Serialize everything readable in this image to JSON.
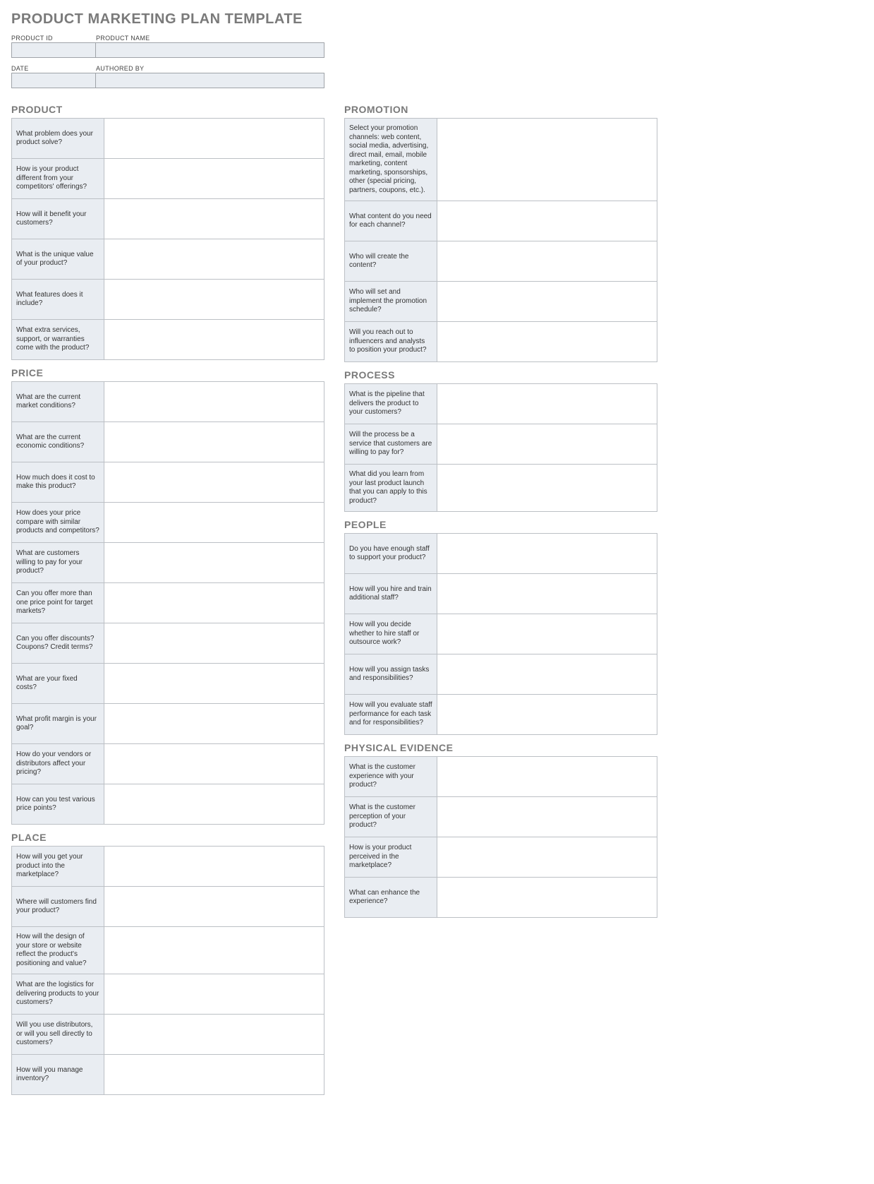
{
  "title": "PRODUCT MARKETING PLAN TEMPLATE",
  "meta": {
    "product_id": {
      "label": "PRODUCT ID",
      "value": ""
    },
    "product_name": {
      "label": "PRODUCT NAME",
      "value": ""
    },
    "date": {
      "label": "DATE",
      "value": ""
    },
    "authored_by": {
      "label": "AUTHORED BY",
      "value": ""
    }
  },
  "left": {
    "product": {
      "title": "PRODUCT",
      "rows": [
        "What problem does your product solve?",
        "How is your product different from your competitors' offerings?",
        "How will it benefit your customers?",
        "What is the unique value of your product?",
        "What features does it include?",
        "What extra services, support, or warranties come with the product?"
      ]
    },
    "price": {
      "title": "PRICE",
      "rows": [
        "What are the current market conditions?",
        "What are the current economic conditions?",
        "How much does it cost to make this product?",
        "How does your price compare with similar products and competitors?",
        "What are customers willing to pay for your product?",
        "Can you offer more than one price point for target markets?",
        "Can you offer discounts? Coupons? Credit terms?",
        "What are your fixed costs?",
        "What profit margin is your goal?",
        "How do your vendors or distributors affect your pricing?",
        "How can you test various price points?"
      ]
    },
    "place": {
      "title": "PLACE",
      "rows": [
        "How will you get your product into the marketplace?",
        "Where will customers find your product?",
        "How will the design of your store or website reflect the product's positioning and value?",
        "What are the logistics for delivering products to your customers?",
        "Will you use distributors, or will you sell directly to customers?",
        "How will you manage inventory?"
      ]
    }
  },
  "right": {
    "promotion": {
      "title": "PROMOTION",
      "rows": [
        "Select your promotion channels: web content, social media, advertising, direct mail, email, mobile marketing, content marketing, sponsorships, other (special pricing, partners, coupons, etc.).",
        "What content do you need for each channel?",
        "Who will create the content?",
        "Who will set and implement the promotion schedule?",
        "Will you reach out to influencers and analysts to position your product?"
      ]
    },
    "process": {
      "title": "PROCESS",
      "rows": [
        "What is the pipeline that delivers the product to your customers?",
        "Will the process be a service that customers are willing to pay for?",
        "What did you learn from your last product launch that you can apply to this product?"
      ]
    },
    "people": {
      "title": "PEOPLE",
      "rows": [
        "Do you have enough staff to support your product?",
        "How will you hire and train additional staff?",
        "How will you decide whether to hire staff or outsource work?",
        "How will you assign tasks and responsibilities?",
        "How will you evaluate staff performance for each task and for responsibilities?"
      ]
    },
    "evidence": {
      "title": "PHYSICAL EVIDENCE",
      "rows": [
        "What is the customer experience with your product?",
        "What is the customer perception of your product?",
        "How is your product perceived in the marketplace?",
        "What can enhance the experience?"
      ]
    }
  }
}
